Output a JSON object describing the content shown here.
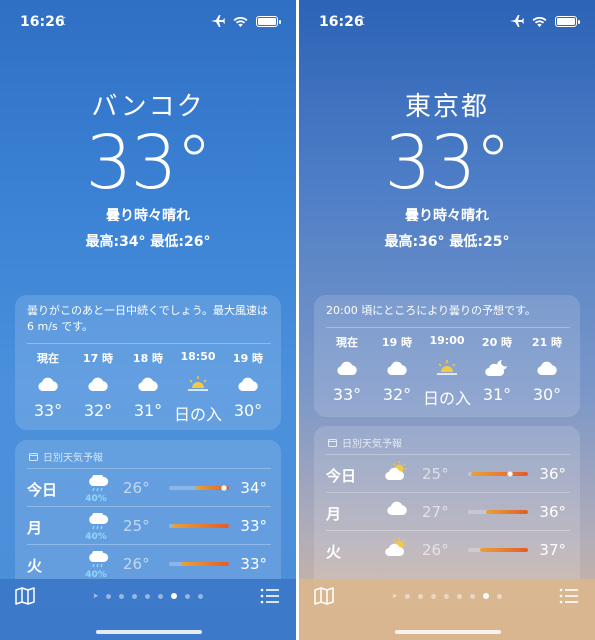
{
  "left": {
    "status": {
      "time": "16:26"
    },
    "city": "バンコク",
    "temperature": "33°",
    "condition": "曇り時々晴れ",
    "high_low": "最高:34°  最低:26°",
    "summary": "曇りがこのあと一日中続くでしょう。最大風速は 6 m/s です。",
    "hourly": [
      {
        "label": "現在",
        "icon": "cloud-icon",
        "temp": "33°"
      },
      {
        "label": "17 時",
        "icon": "cloud-icon",
        "temp": "32°"
      },
      {
        "label": "18 時",
        "icon": "cloud-icon",
        "temp": "31°"
      },
      {
        "label": "18:50",
        "icon": "sunset-icon",
        "temp": "日の入"
      },
      {
        "label": "19 時",
        "icon": "cloud-icon",
        "temp": "30°"
      }
    ],
    "daily_header": "日別天気予報",
    "daily": [
      {
        "day": "今日",
        "icon": "rain-cloud-icon",
        "precip": "40%",
        "low": "26°",
        "high": "34°",
        "bar_start": 0.45,
        "bar_end": 1.0,
        "current_pos": 0.92
      },
      {
        "day": "月",
        "icon": "rain-cloud-icon",
        "precip": "40%",
        "low": "25°",
        "high": "33°",
        "bar_start": 0.05,
        "bar_end": 1.0,
        "current_pos": null
      },
      {
        "day": "火",
        "icon": "rain-cloud-icon",
        "precip": "40%",
        "low": "26°",
        "high": "33°",
        "bar_start": 0.2,
        "bar_end": 1.0,
        "current_pos": null
      }
    ]
  },
  "right": {
    "status": {
      "time": "16:26"
    },
    "city": "東京都",
    "temperature": "33°",
    "condition": "曇り時々晴れ",
    "high_low": "最高:36°  最低:25°",
    "summary": "20:00 頃にところにより曇りの予想です。",
    "hourly": [
      {
        "label": "現在",
        "icon": "cloud-icon",
        "temp": "33°"
      },
      {
        "label": "19 時",
        "icon": "cloud-icon",
        "temp": "32°"
      },
      {
        "label": "19:00",
        "icon": "sunset-icon",
        "temp": "日の入"
      },
      {
        "label": "20 時",
        "icon": "cloud-moon-icon",
        "temp": "31°"
      },
      {
        "label": "21 時",
        "icon": "cloud-icon",
        "temp": "30°"
      }
    ],
    "daily_header": "日別天気予報",
    "daily": [
      {
        "day": "今日",
        "icon": "sun-cloud-icon",
        "precip": "",
        "low": "25°",
        "high": "36°",
        "bar_start": 0.05,
        "bar_end": 1.0,
        "current_pos": 0.7
      },
      {
        "day": "月",
        "icon": "cloud-icon",
        "precip": "",
        "low": "27°",
        "high": "36°",
        "bar_start": 0.3,
        "bar_end": 1.0,
        "current_pos": null
      },
      {
        "day": "火",
        "icon": "sun-cloud-icon",
        "precip": "",
        "low": "26°",
        "high": "37°",
        "bar_start": 0.2,
        "bar_end": 1.0,
        "current_pos": null
      }
    ]
  },
  "colors": {
    "left_sky_top": "#2f6fc4",
    "right_sky_bottom": "#d9b68f",
    "temp_bar_start": "#e8a23a",
    "temp_bar_end": "#e45b2a",
    "precip_text": "#8fd6ff"
  }
}
